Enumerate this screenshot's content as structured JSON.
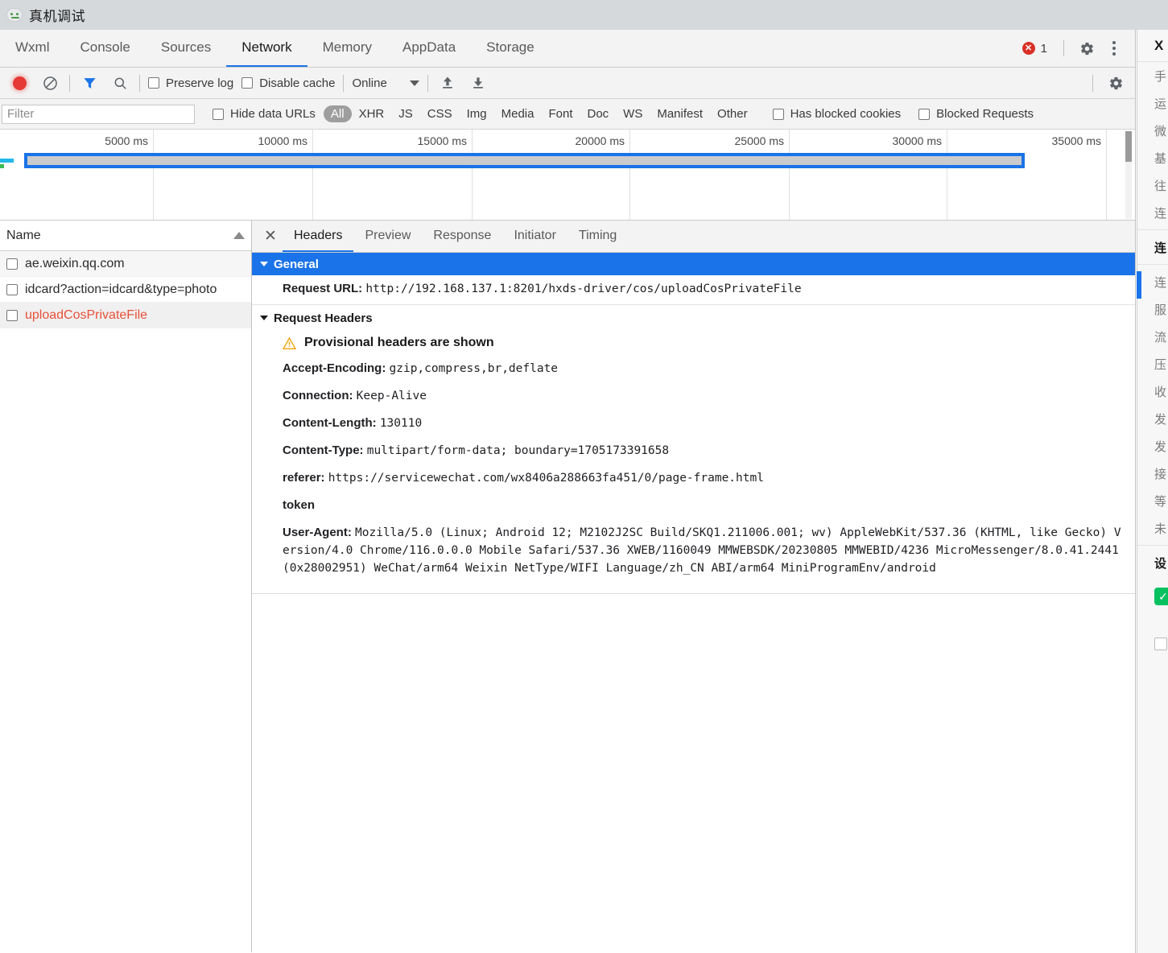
{
  "window": {
    "title": "真机调试",
    "logo_icon": "wechat-devtools-logo"
  },
  "tabs": {
    "items": [
      {
        "label": "Wxml",
        "active": false
      },
      {
        "label": "Console",
        "active": false
      },
      {
        "label": "Sources",
        "active": false
      },
      {
        "label": "Network",
        "active": true
      },
      {
        "label": "Memory",
        "active": false
      },
      {
        "label": "AppData",
        "active": false
      },
      {
        "label": "Storage",
        "active": false
      }
    ],
    "error_count": "1",
    "error_icon": "error-circle-icon",
    "settings_icon": "gear-icon",
    "more_icon": "kebab-menu-icon"
  },
  "network_toolbar": {
    "record_icon": "record-button-icon",
    "clear_icon": "clear-requests-icon",
    "filter_icon": "filter-funnel-icon",
    "search_icon": "search-icon",
    "preserve_log": {
      "label": "Preserve log",
      "checked": false
    },
    "disable_cache": {
      "label": "Disable cache",
      "checked": false
    },
    "throttle": {
      "value": "Online",
      "caret_icon": "chevron-down-icon"
    },
    "import_icon": "import-har-up-arrow-icon",
    "export_icon": "export-har-down-arrow-icon",
    "settings_icon": "gear-icon"
  },
  "filter_bar": {
    "filter_placeholder": "Filter",
    "filter_value": "",
    "hide_data_urls": {
      "label": "Hide data URLs",
      "checked": false
    },
    "types": [
      {
        "label": "All",
        "active": true
      },
      {
        "label": "XHR",
        "active": false
      },
      {
        "label": "JS",
        "active": false
      },
      {
        "label": "CSS",
        "active": false
      },
      {
        "label": "Img",
        "active": false
      },
      {
        "label": "Media",
        "active": false
      },
      {
        "label": "Font",
        "active": false
      },
      {
        "label": "Doc",
        "active": false
      },
      {
        "label": "WS",
        "active": false
      },
      {
        "label": "Manifest",
        "active": false
      },
      {
        "label": "Other",
        "active": false
      }
    ],
    "has_blocked_cookies": {
      "label": "Has blocked cookies",
      "checked": false
    },
    "blocked_requests": {
      "label": "Blocked Requests",
      "checked": false
    }
  },
  "overview": {
    "ticks": [
      "5000 ms",
      "10000 ms",
      "15000 ms",
      "20000 ms",
      "25000 ms",
      "30000 ms",
      "35000 ms"
    ],
    "scrollbar_icon": "vertical-scrollbar"
  },
  "request_list": {
    "column_header": "Name",
    "sort_icon": "sort-ascending-arrow-icon",
    "rows": [
      {
        "name": "ae.weixin.qq.com",
        "error": false,
        "selected": false
      },
      {
        "name": "idcard?action=idcard&type=photo",
        "error": false,
        "selected": false
      },
      {
        "name": "uploadCosPrivateFile",
        "error": true,
        "selected": true
      }
    ]
  },
  "details": {
    "close_icon": "close-icon",
    "tabs": [
      {
        "label": "Headers",
        "active": true
      },
      {
        "label": "Preview",
        "active": false
      },
      {
        "label": "Response",
        "active": false
      },
      {
        "label": "Initiator",
        "active": false
      },
      {
        "label": "Timing",
        "active": false
      }
    ],
    "general": {
      "section_title": "General",
      "request_url_key": "Request URL:",
      "request_url_value": "http://192.168.137.1:8201/hxds-driver/cos/uploadCosPrivateFile"
    },
    "request_headers": {
      "section_title": "Request Headers",
      "warning_icon": "warning-triangle-icon",
      "warning_text": "Provisional headers are shown",
      "items": [
        {
          "key": "Accept-Encoding:",
          "value": "gzip,compress,br,deflate"
        },
        {
          "key": "Connection:",
          "value": "Keep-Alive"
        },
        {
          "key": "Content-Length:",
          "value": "130110"
        },
        {
          "key": "Content-Type:",
          "value": "multipart/form-data; boundary=1705173391658"
        },
        {
          "key": "referer:",
          "value": "https://servicewechat.com/wx8406a288663fa451/0/page-frame.html"
        },
        {
          "key": "token",
          "value": ""
        },
        {
          "key": "User-Agent:",
          "value": "Mozilla/5.0 (Linux; Android 12; M2102J2SC Build/SKQ1.211006.001; wv) AppleWebKit/537.36 (KHTML, like Gecko) Version/4.0 Chrome/116.0.0.0 Mobile Safari/537.36 XWEB/1160049 MMWEBSDK/20230805 MMWEBID/4236 MicroMessenger/8.0.41.2441(0x28002951) WeChat/arm64 Weixin NetType/WIFI Language/zh_CN ABI/arm64 MiniProgramEnv/android"
        }
      ]
    }
  },
  "right_panel": {
    "header": "X",
    "items": [
      "手",
      "运",
      "微",
      "基",
      "往",
      "连"
    ],
    "highlight_item": "连",
    "items2": [
      "连",
      "服",
      "流",
      "压",
      "收",
      "发",
      "发",
      "接",
      "等",
      "未"
    ],
    "footer_item": "设",
    "check_icon": "green-check-icon",
    "checkbox_icon": "empty-checkbox-icon"
  },
  "colors": {
    "accent": "#1a73e8",
    "error": "#e8503a",
    "warning": "#f2a208",
    "record": "#e53935",
    "wechat_green": "#07c160"
  }
}
